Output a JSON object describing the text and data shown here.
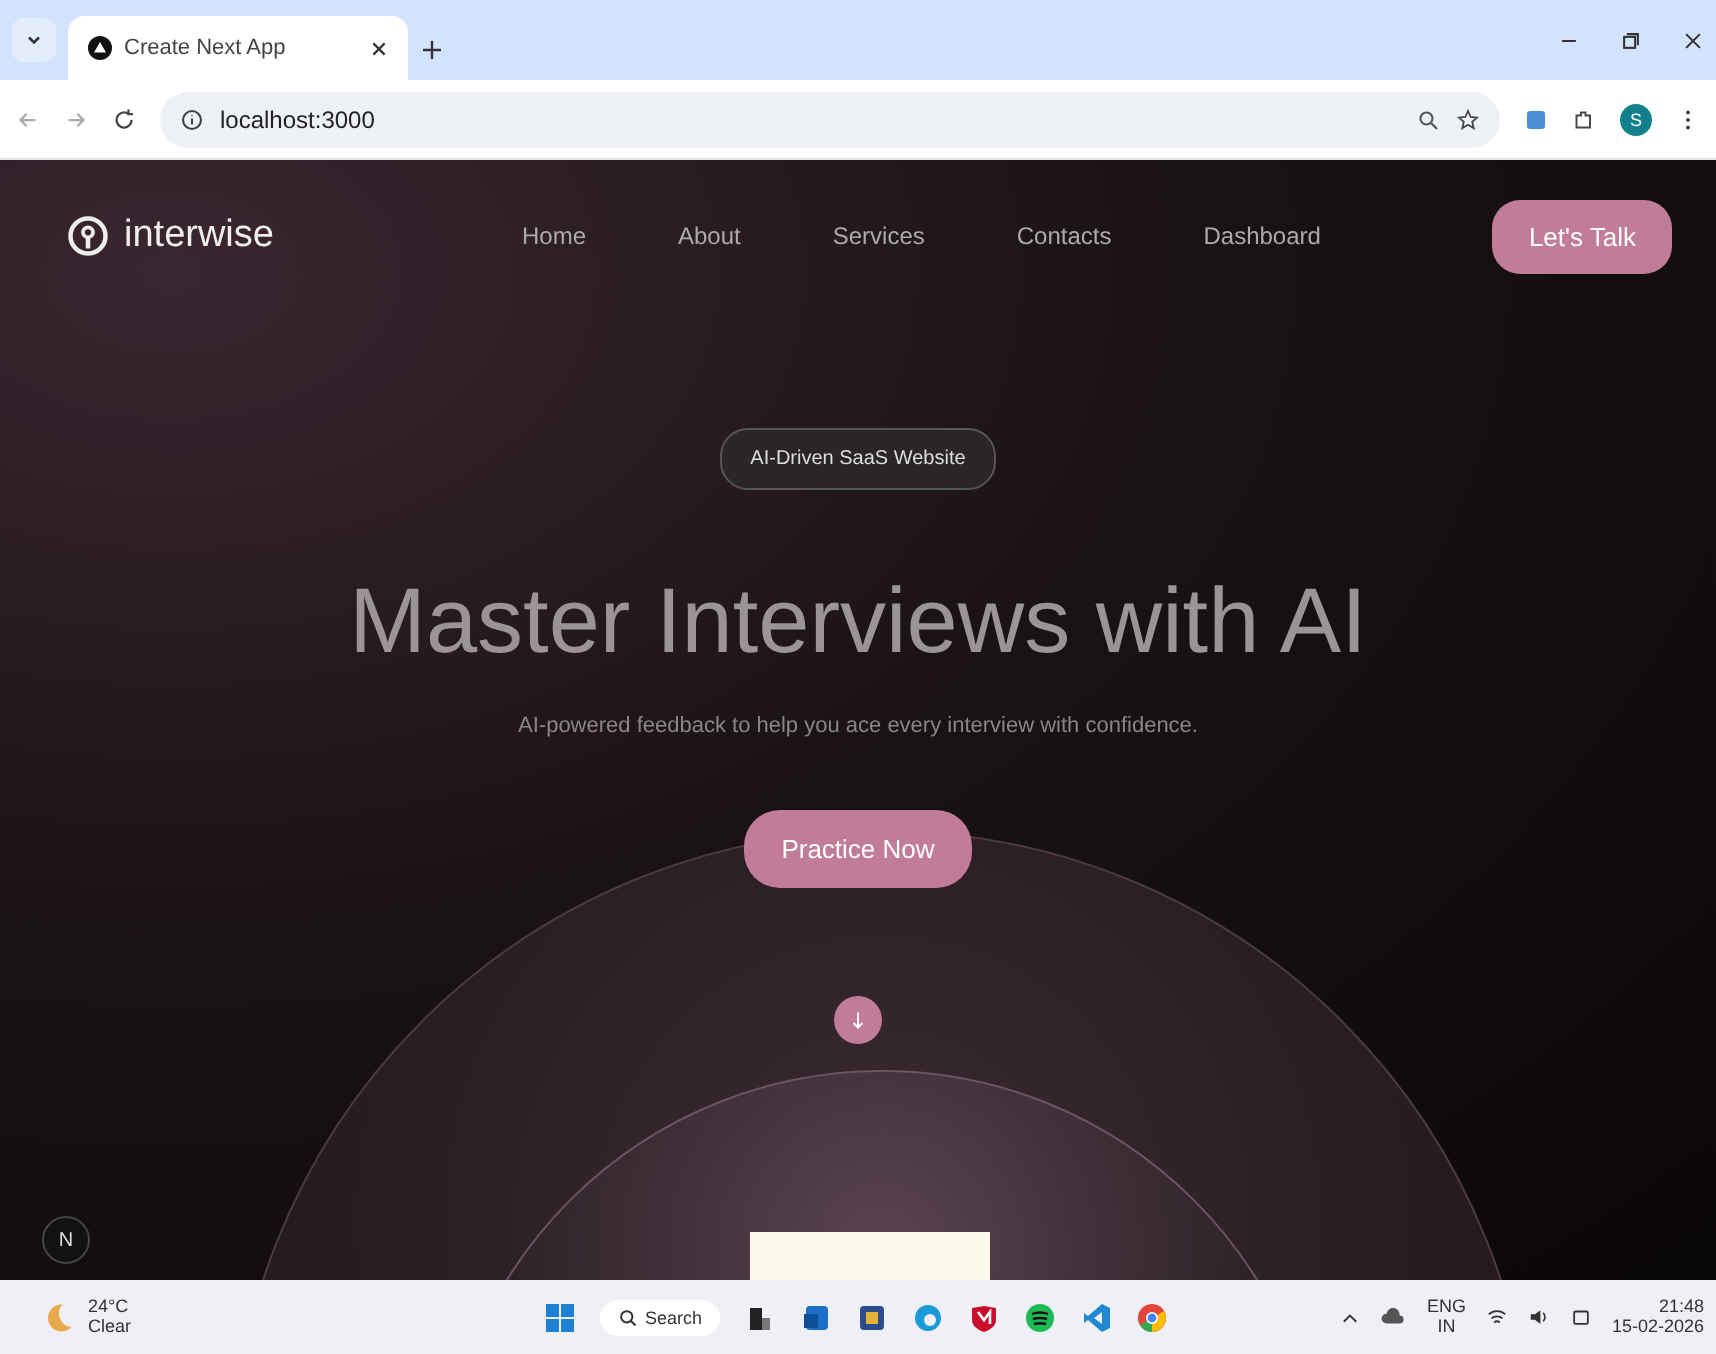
{
  "browser": {
    "tab_title": "Create Next App",
    "url": "localhost:3000",
    "profile_initial": "S"
  },
  "nav": {
    "brand": "interwise",
    "items": [
      "Home",
      "About",
      "Services",
      "Contacts",
      "Dashboard"
    ],
    "cta": "Let's Talk"
  },
  "hero": {
    "badge": "AI-Driven SaaS Website",
    "headline": "Master Interviews with AI",
    "subtitle": "AI-powered feedback to help you ace every interview with confidence.",
    "button": "Practice Now"
  },
  "dev_badge": "N",
  "taskbar": {
    "temperature": "24°C",
    "weather": "Clear",
    "search": "Search",
    "language": "ENG",
    "region": "IN",
    "time": "21:48",
    "date": "15-02-2026"
  }
}
